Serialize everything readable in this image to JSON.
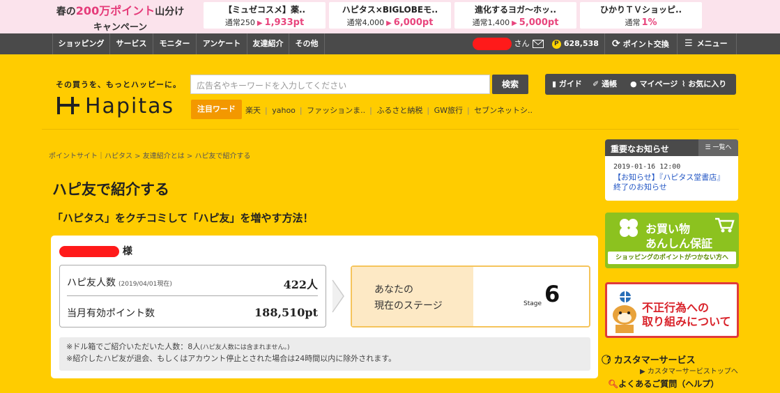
{
  "promo": {
    "campaign_line1_pre": "春の",
    "campaign_line1_em": "200万ポイント",
    "campaign_line1_post": "山分け",
    "campaign_line2": "キャンペーン",
    "cards": [
      {
        "title": "【ミュゼコスメ】薬..",
        "normal": "通常250",
        "points": "1,933pt"
      },
      {
        "title": "ハピタス×BIGLOBEモ..",
        "normal": "通常4,000",
        "points": "6,000pt"
      },
      {
        "title": "進化するヨガ〜ホッ..",
        "normal": "通常1,400",
        "points": "5,000pt"
      },
      {
        "title": "ひかりＴＶショッピ..",
        "normal": "通常",
        "points": "1%"
      }
    ]
  },
  "nav": {
    "items": [
      "ショッピング",
      "サービス",
      "モニター",
      "アンケート",
      "友達紹介",
      "その他"
    ],
    "user_suffix": "さん",
    "points": "628,538",
    "coin_glyph": "P",
    "exchange": "ポイント交換",
    "menu": "メニュー"
  },
  "header": {
    "tagline": "その買うを、もっとハッピーに。",
    "logo": "Hapitas",
    "search_placeholder": "広告名やキーワードを入力してください",
    "search_button": "検索",
    "tools": [
      "ガイド",
      "通帳",
      "マイページ",
      "お気に入り"
    ],
    "hot_label": "注目ワード",
    "hot_words": [
      "楽天",
      "yahoo",
      "ファッションま..",
      "ふるさと納税",
      "GW旅行",
      "セブンネットシ.."
    ]
  },
  "breadcrumb": "ポイントサイト｜ハピタス > 友達紹介とは > ハピ友で紹介する",
  "main": {
    "title": "ハピ友で紹介する",
    "subtitle": "「ハピタス」をクチコミして「ハピ友」を増やす方法！",
    "name_suffix": "様",
    "friends_label": "ハピ友人数",
    "friends_date": "(2019/04/01現在)",
    "friends_value": "422人",
    "points_label": "当月有効ポイント数",
    "points_value": "188,510pt",
    "stage_line1": "あなたの",
    "stage_line2": "現在のステージ",
    "stage_label": "Stage",
    "stage_value": "6",
    "note_line1": "※ドル箱でご紹介いただいた人数：8人",
    "note_line1_small": "(ハピ友人数には含まれません。)",
    "note_line2": "※紹介したハピ友が退会、もしくはアカウント停止とされた場合は24時間以内に除外されます。"
  },
  "sidebar": {
    "notice_title": "重要なお知らせ",
    "notice_all": "一覧へ",
    "notice_date": "2019-01-16 12:00",
    "notice_link": "【お知らせ】『ハピタス堂書店』終了のお知らせ",
    "safe_line1": "お買い物",
    "safe_line2": "あんしん保証",
    "safe_bar": "ショッピングのポイントがつかない方へ",
    "fraud_line1": "不正行為への",
    "fraud_line2": "取り組みについて",
    "cs_title": "カスタマーサービス",
    "cs_link": "カスタマーサービストップへ",
    "faq": "よくあるご質問（ヘルプ）"
  },
  "colors": {
    "background": "#ffcc00",
    "dark": "#4a4a4a",
    "accent_pink": "#e8457d",
    "hot_orange": "#f39800",
    "safe_green": "#8cc21f",
    "fraud_red": "#e03a3a"
  }
}
